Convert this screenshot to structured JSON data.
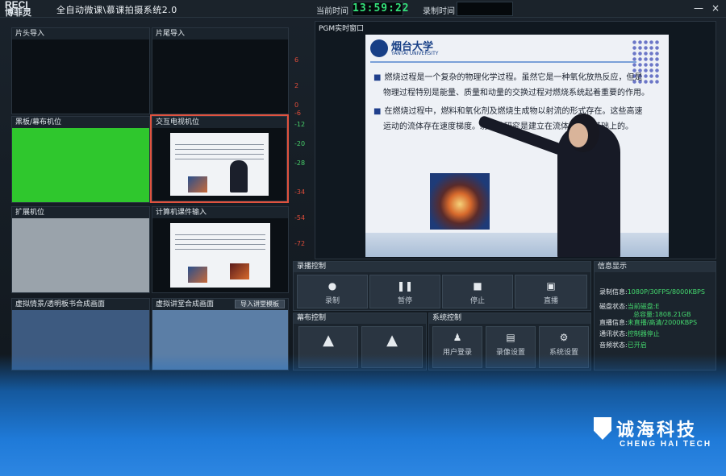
{
  "app": {
    "logo_top": "RECI",
    "logo_brand": "博菲灵",
    "title": "全自动微课\\慕课拍摄系统2.0",
    "current_time_label": "当前时间",
    "current_time": "13:59:22",
    "rec_time_label": "录制时间",
    "window_controls": [
      "—",
      "×"
    ]
  },
  "tiles": [
    {
      "label": "片头导入"
    },
    {
      "label": "片尾导入"
    },
    {
      "label": "黑板/幕布机位"
    },
    {
      "label": "交互电视机位"
    },
    {
      "label": "扩展机位"
    },
    {
      "label": "计算机课件输入"
    },
    {
      "label": "虚拟情景/透明板书合成画面"
    },
    {
      "label": "虚拟讲堂合成画面"
    }
  ],
  "import_scene_button": "导入讲堂模板",
  "meter_ticks": [
    "6",
    "2",
    "0",
    "-6",
    "-12",
    "-20",
    "-28",
    "-34",
    "-54",
    "-72"
  ],
  "live": {
    "title": "PGM实时窗口",
    "slide": {
      "university_cn": "烟台大学",
      "university_en": "YANTAI UNIVERSITY",
      "p1": "燃烧过程是一个复杂的物理化学过程。虽然它是一种氧化放热反应，但是物理过程特别是能量、质量和动量的交换过程对燃烧系统起着重要的作用。",
      "p2": "在燃烧过程中，燃料和氧化剂及燃烧生成物以射流的形式存在。这些高速运动的流体存在速度梯度。射流的研究是建立在流体力学的基础上的。"
    }
  },
  "record_panel": {
    "title": "录播控制",
    "buttons": [
      {
        "icon": "record-icon",
        "glyph": "●",
        "label": "录制"
      },
      {
        "icon": "pause-icon",
        "glyph": "❚❚",
        "label": "暂停"
      },
      {
        "icon": "stop-icon",
        "glyph": "■",
        "label": "停止"
      },
      {
        "icon": "tv-icon",
        "glyph": "▣",
        "label": "直播"
      }
    ]
  },
  "curtain_panel": {
    "title": "幕布控制"
  },
  "system_panel": {
    "title": "系统控制",
    "buttons": [
      {
        "icon": "user-icon",
        "glyph": "♟",
        "label": "用户登录"
      },
      {
        "icon": "record-settings-icon",
        "glyph": "▤",
        "label": "录像设置"
      },
      {
        "icon": "gear-icon",
        "glyph": "⚙",
        "label": "系统设置"
      }
    ]
  },
  "info_panel": {
    "title": "信息显示",
    "rows": [
      {
        "label": "录制信息:",
        "value": "1080P/30FPS/8000KBPS"
      },
      {
        "label": "磁盘状态:",
        "value": "当前磁盘:E"
      },
      {
        "label": "",
        "value": "总容量:1808.21GB"
      },
      {
        "label": "直播信息:",
        "value": "未直播/高清/2000KBPS"
      },
      {
        "label": "通讯状态:",
        "value": "控制器停止"
      },
      {
        "label": "音频状态:",
        "value": "已开启"
      }
    ]
  },
  "brand": {
    "cn": "诚海科技",
    "en": "CHENG HAI TECH"
  }
}
